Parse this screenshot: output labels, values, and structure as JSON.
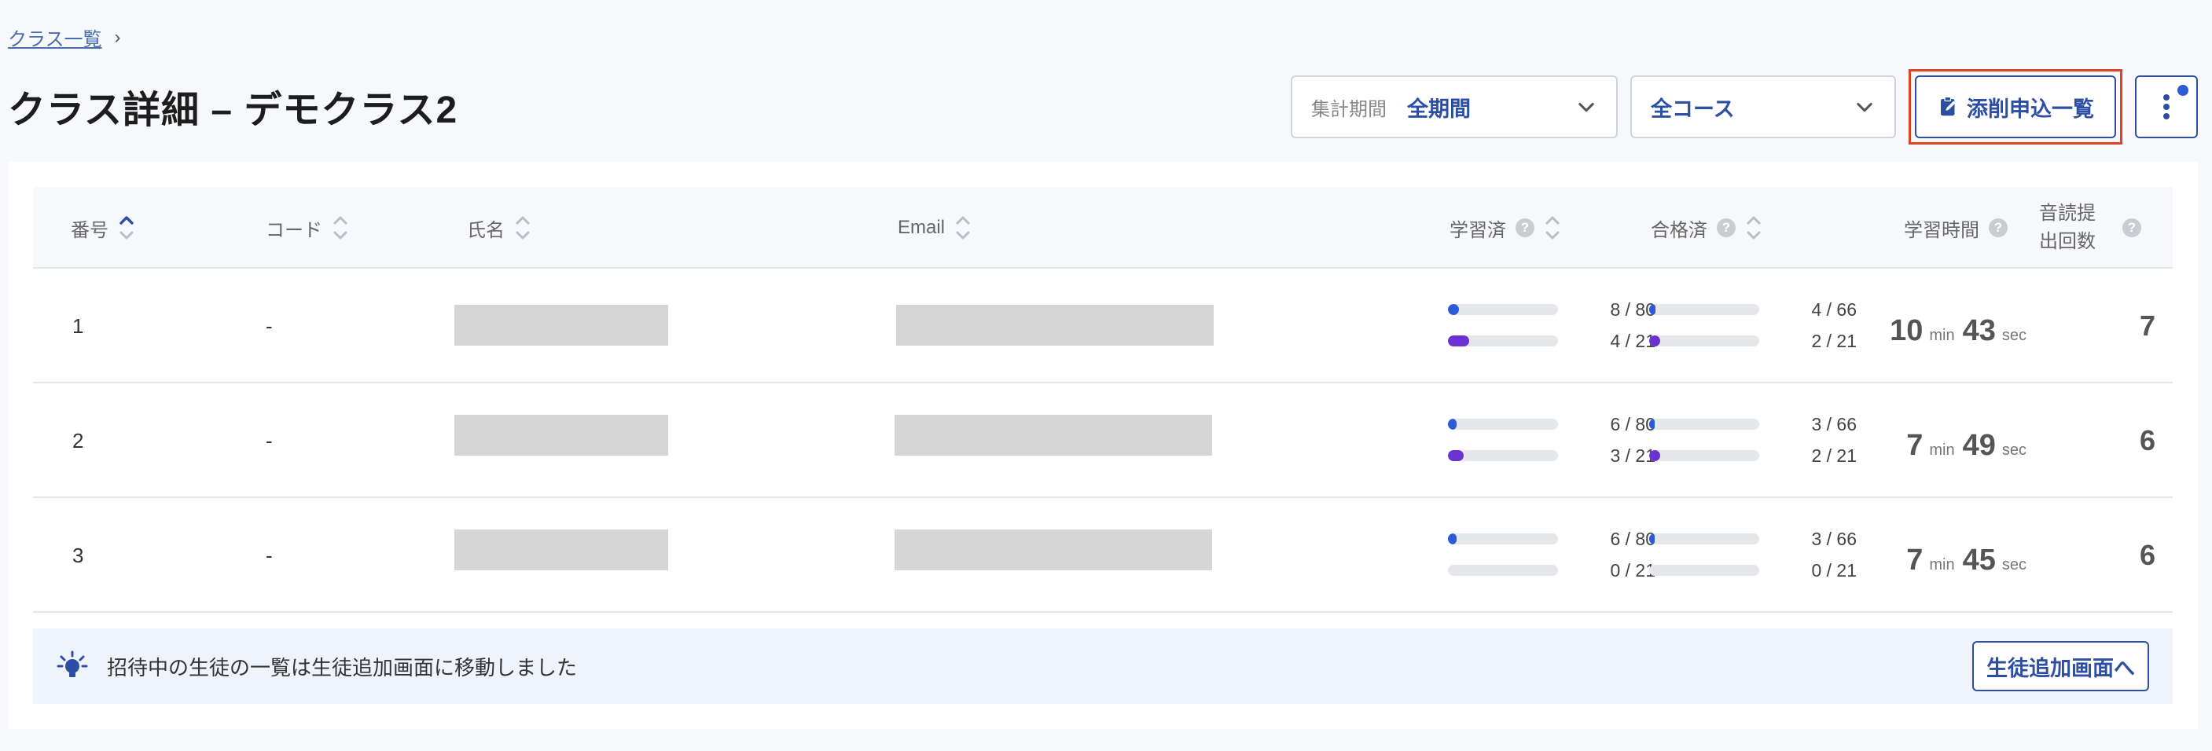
{
  "breadcrumb": {
    "parent": "クラス一覧",
    "separator": "›"
  },
  "page_title": "クラス詳細 – デモクラス2",
  "filters": {
    "period_label": "集計期間",
    "period_value": "全期間",
    "course_value": "全コース"
  },
  "actions": {
    "correction_list": "添削申込一覧",
    "more_icon": "kebab-menu-icon"
  },
  "table": {
    "headers": {
      "number": "番号",
      "code": "コード",
      "name": "氏名",
      "email": "Email",
      "learned": "学習済",
      "passed": "合格済",
      "study_time": "学習時間",
      "reading_count_1": "音読提",
      "reading_count_2": "出回数"
    },
    "help_glyph": "?",
    "rows": [
      {
        "number": "1",
        "code": "-",
        "learned_a": "8 / 80",
        "learned_b": "4 / 21",
        "passed_a": "4 / 66",
        "passed_b": "2 / 21",
        "min": "10",
        "min_unit": "min",
        "sec": "43",
        "sec_unit": "sec",
        "count": "7"
      },
      {
        "number": "2",
        "code": "-",
        "learned_a": "6 / 80",
        "learned_b": "3 / 21",
        "passed_a": "3 / 66",
        "passed_b": "2 / 21",
        "min": "7",
        "min_unit": "min",
        "sec": "49",
        "sec_unit": "sec",
        "count": "6"
      },
      {
        "number": "3",
        "code": "-",
        "learned_a": "6 / 80",
        "learned_b": "0 / 21",
        "passed_a": "3 / 66",
        "passed_b": "0 / 21",
        "min": "7",
        "min_unit": "min",
        "sec": "45",
        "sec_unit": "sec",
        "count": "6"
      }
    ]
  },
  "notice": {
    "message": "招待中の生徒の一覧は生徒追加画面に移動しました",
    "button": "生徒追加画面へ"
  },
  "colors": {
    "accent": "#2d4fa3",
    "bar_blue": "#2d5bd6",
    "bar_purple": "#6a32d2",
    "highlight_border": "#e0401e"
  }
}
